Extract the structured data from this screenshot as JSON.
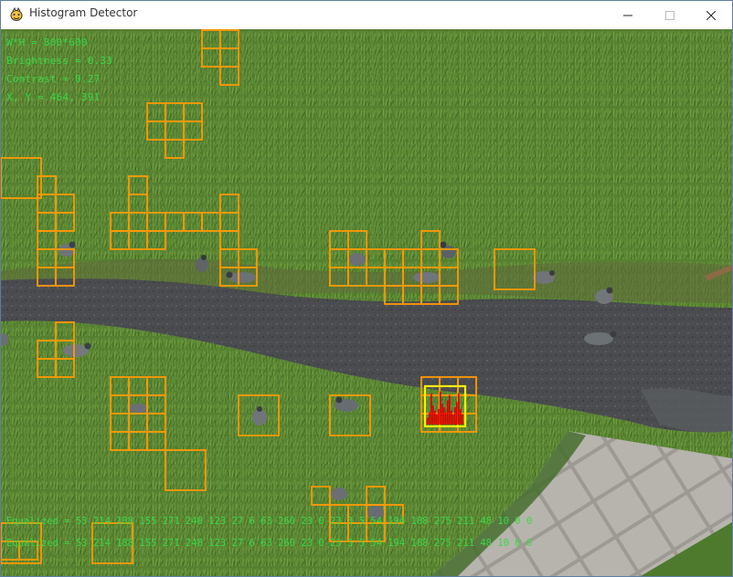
{
  "window": {
    "title": "Histogram Detector",
    "accent": "#5d7fa3"
  },
  "hud": {
    "size": "W*H = 800*600",
    "brightness": "Brightness = 0.33",
    "contrast": "Contrast = 0.27",
    "cursor": "X, Y = 464, 391"
  },
  "equalized": {
    "line1": "Equalized = 53 214 188 155 271 248 123 27 6 63 260 23 0 23 3 5 54 194 188 275 211 48 10 0 0",
    "line2": "Equalized = 53 214 188 155 271 248 123 27 6 63 260 23 0 23 3 5 54 194 188 275 211 48 10 0 0"
  },
  "colors": {
    "box": "#ff9900",
    "highlight": "#ffee00",
    "histogram": "#e00000",
    "hud_text": "#39d84a"
  },
  "icons": [
    "pygame-icon",
    "minimize-icon",
    "maximize-icon",
    "close-icon"
  ],
  "histogram": {
    "levels": [
      0.2,
      0.35,
      0.9,
      0.55,
      0.4,
      0.3,
      0.45,
      0.95,
      0.6,
      0.5,
      0.35,
      0.7,
      0.85,
      0.4,
      0.3,
      0.5,
      0.65,
      0.9,
      0.45,
      0.3
    ]
  }
}
